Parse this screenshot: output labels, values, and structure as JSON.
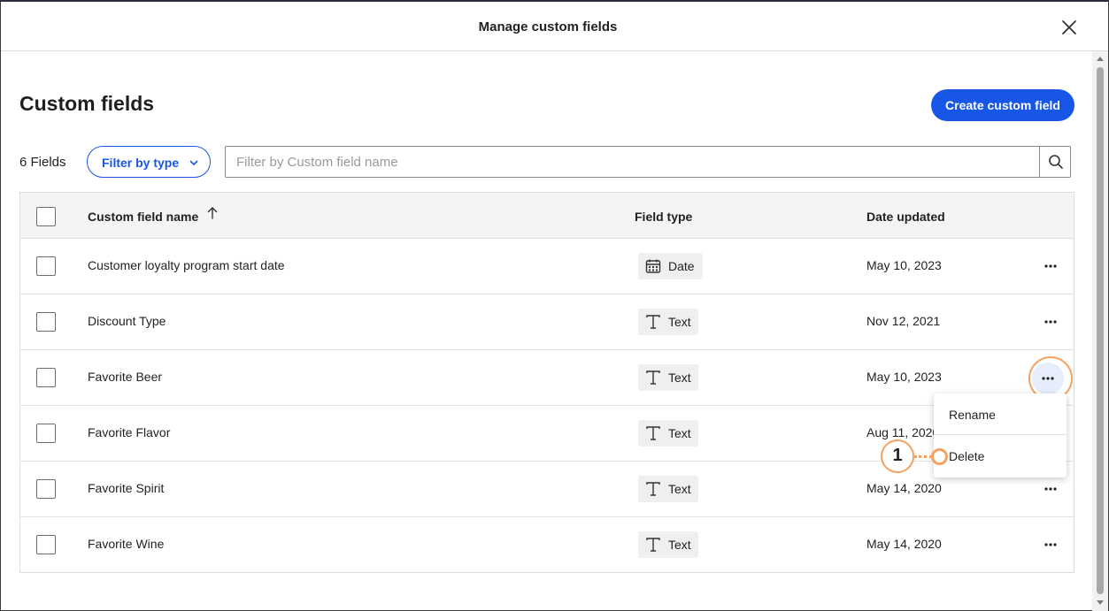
{
  "dialog": {
    "title": "Manage custom fields"
  },
  "page": {
    "title": "Custom fields",
    "create_button": "Create custom field",
    "field_count": "6 Fields",
    "filter_type_label": "Filter by type",
    "search_placeholder": "Filter by Custom field name"
  },
  "table": {
    "columns": {
      "name": "Custom field name",
      "type": "Field type",
      "date": "Date updated"
    },
    "rows": [
      {
        "name": "Customer loyalty program start date",
        "type": "Date",
        "type_icon": "calendar-icon",
        "date": "May 10, 2023"
      },
      {
        "name": "Discount Type",
        "type": "Text",
        "type_icon": "text-type-icon",
        "date": "Nov 12, 2021"
      },
      {
        "name": "Favorite Beer",
        "type": "Text",
        "type_icon": "text-type-icon",
        "date": "May 10, 2023"
      },
      {
        "name": "Favorite Flavor",
        "type": "Text",
        "type_icon": "text-type-icon",
        "date": "Aug 11, 2020"
      },
      {
        "name": "Favorite Spirit",
        "type": "Text",
        "type_icon": "text-type-icon",
        "date": "May 14, 2020"
      },
      {
        "name": "Favorite Wine",
        "type": "Text",
        "type_icon": "text-type-icon",
        "date": "May 14, 2020"
      }
    ]
  },
  "context_menu": {
    "items": [
      "Rename",
      "Delete"
    ]
  },
  "callout": {
    "number": "1"
  },
  "colors": {
    "primary": "#1857e6",
    "highlight": "#f4a262"
  }
}
